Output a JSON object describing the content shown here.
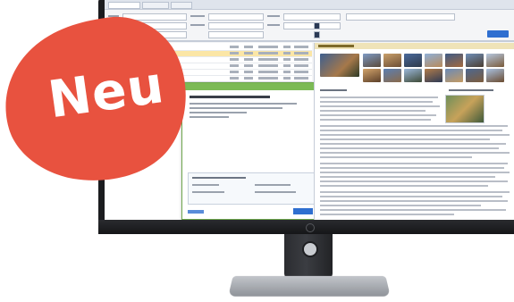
{
  "badge": {
    "text": "Neu",
    "color": "#e8523f"
  },
  "monitor": {
    "bezel_color": "#1b1c1f",
    "stand_color": "#b9bcc1"
  },
  "app": {
    "accent_color": "#2f6fd0",
    "selection_color": "#fbe6a6",
    "dialog_accent": "#7cba55"
  }
}
